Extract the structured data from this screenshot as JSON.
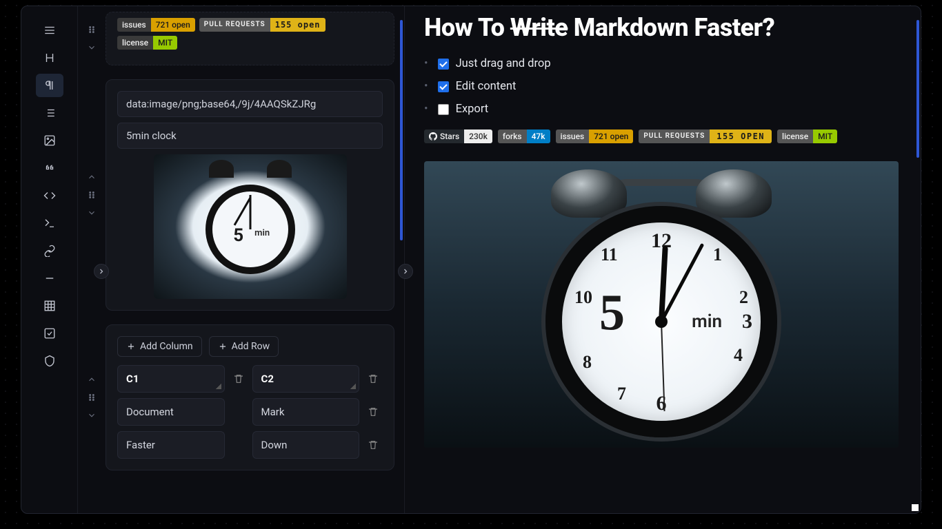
{
  "toolbar": {
    "items": [
      "menu",
      "heading",
      "paragraph",
      "list",
      "image",
      "quote",
      "code",
      "terminal",
      "link",
      "hr",
      "table",
      "checklist",
      "shield"
    ],
    "active_index": 2
  },
  "blocks": {
    "badges_small": {
      "issues_label": "issues",
      "issues_value": "721 open",
      "pr_label": "pull requests",
      "pr_value": "155 open",
      "license_label": "license",
      "license_value": "MIT"
    },
    "image_block": {
      "src_field": "data:image/png;base64,/9j/4AAQSkZJRg",
      "alt_field": "5min clock",
      "face_big_number": "5",
      "face_text": "min"
    },
    "table_block": {
      "add_column": "Add Column",
      "add_row": "Add Row",
      "headers": [
        "C1",
        "C2"
      ],
      "rows": [
        [
          "Document",
          "Mark"
        ],
        [
          "Faster",
          "Down"
        ]
      ]
    }
  },
  "preview": {
    "title_pre": "How To ",
    "title_strike": "Write",
    "title_post": " Markdown Faster?",
    "checklist": [
      {
        "label": "Just drag and drop",
        "checked": true
      },
      {
        "label": "Edit content",
        "checked": true
      },
      {
        "label": "Export",
        "checked": false
      }
    ],
    "badges": {
      "stars_label": "Stars",
      "stars_value": "230k",
      "forks_label": "forks",
      "forks_value": "47k",
      "issues_label": "issues",
      "issues_value": "721 open",
      "pr_label": "PULL REQUESTS",
      "pr_value": "155 OPEN",
      "license_label": "license",
      "license_value": "MIT"
    },
    "clock": {
      "big_number": "5",
      "min_text": "min",
      "numerals": {
        "n12": "12",
        "n1": "1",
        "n2": "2",
        "n3": "3",
        "n4": "4",
        "n6": "6",
        "n7": "7",
        "n8": "8",
        "n10": "10",
        "n11": "11"
      }
    }
  }
}
